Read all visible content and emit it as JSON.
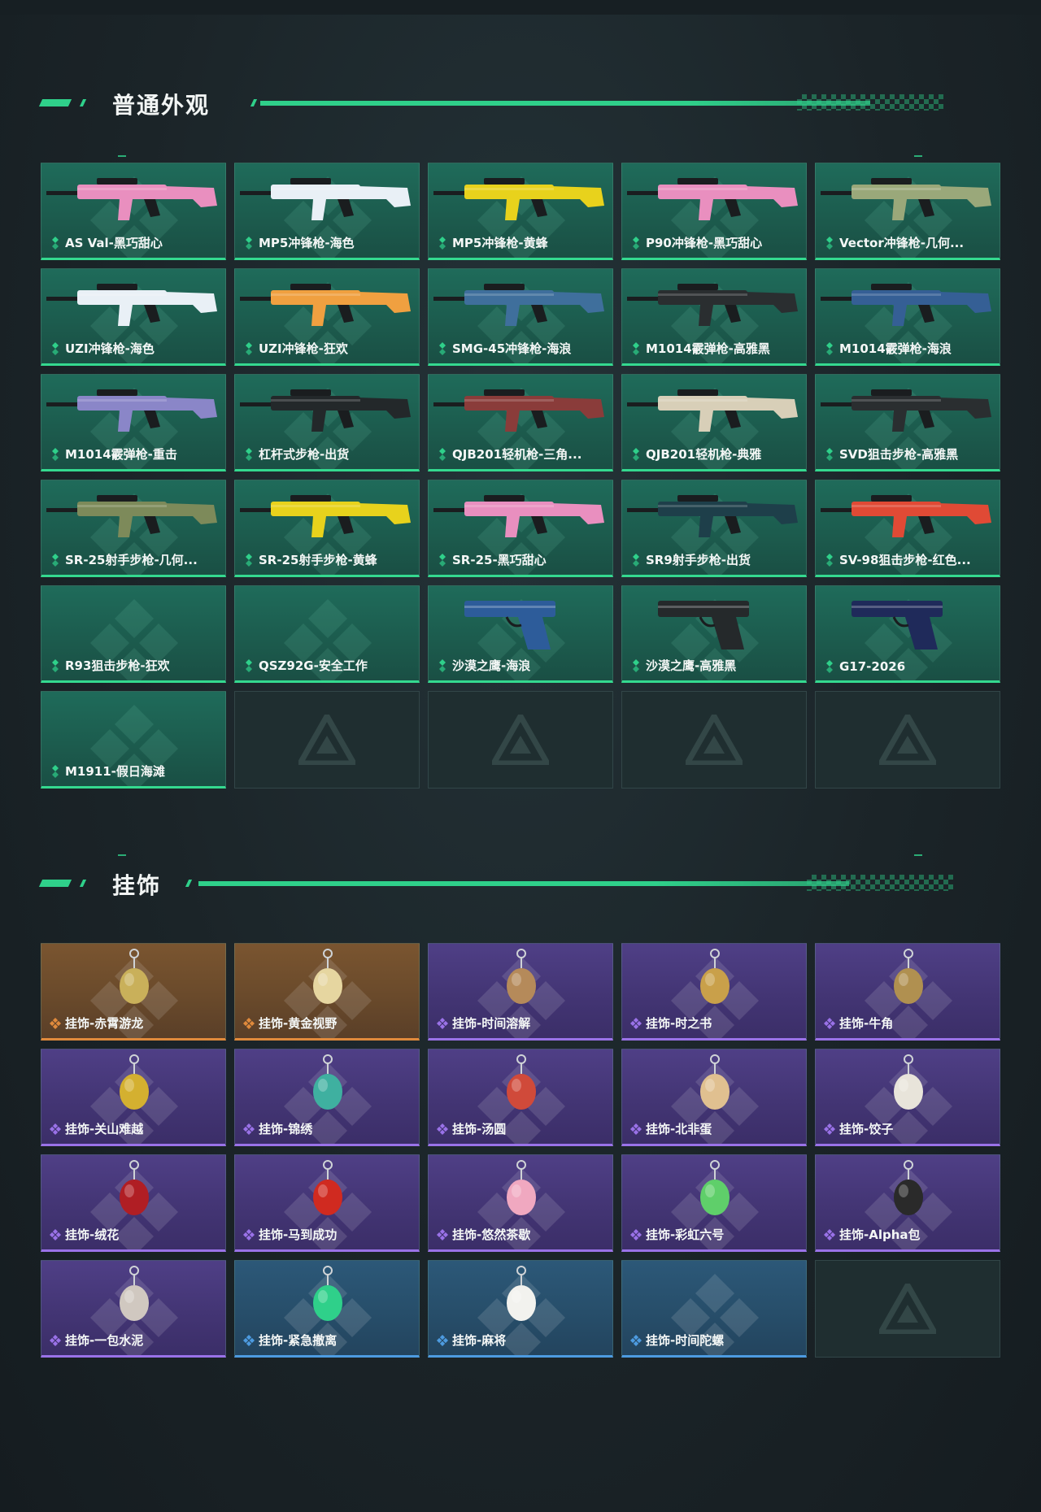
{
  "colors": {
    "accent_green": "#2fd08a",
    "skin_card": "#1f6b5a",
    "purple_card": "#4f3f86",
    "orange_card": "#7a5530",
    "blue_card": "#2c5878",
    "empty_card": "#1f2e30"
  },
  "sections": {
    "skins": {
      "title": "普通外观",
      "items": [
        {
          "label": "AS Val-黑巧甜心",
          "icon": "pink-rifle-icon",
          "tint": "#e98fbf"
        },
        {
          "label": "MP5冲锋枪-海色",
          "icon": "white-smg-icon",
          "tint": "#e9f0f6"
        },
        {
          "label": "MP5冲锋枪-黄蜂",
          "icon": "yellow-smg-icon",
          "tint": "#e8d21c"
        },
        {
          "label": "P90冲锋枪-黑巧甜心",
          "icon": "pink-p90-icon",
          "tint": "#e98fbf"
        },
        {
          "label": "Vector冲锋枪-几何...",
          "icon": "camo-smg-icon",
          "tint": "#9aa87a"
        },
        {
          "label": "UZI冲锋枪-海色",
          "icon": "white-uzi-icon",
          "tint": "#e9f0f6"
        },
        {
          "label": "UZI冲锋枪-狂欢",
          "icon": "colorful-uzi-icon",
          "tint": "#f0a040"
        },
        {
          "label": "SMG-45冲锋枪-海浪",
          "icon": "blue-smg-icon",
          "tint": "#3f6f9c"
        },
        {
          "label": "M1014霰弹枪-高雅黑",
          "icon": "black-shotgun-icon",
          "tint": "#2a2e30"
        },
        {
          "label": "M1014霰弹枪-海浪",
          "icon": "blue-shotgun-icon",
          "tint": "#355f95"
        },
        {
          "label": "M1014霰弹枪-重击",
          "icon": "purple-shotgun-icon",
          "tint": "#8a86c8"
        },
        {
          "label": "杠杆式步枪-出货",
          "icon": "black-rifle-icon",
          "tint": "#23282a"
        },
        {
          "label": "QJB201轻机枪-三角...",
          "icon": "red-lmg-icon",
          "tint": "#8a3c3a"
        },
        {
          "label": "QJB201轻机枪-典雅",
          "icon": "cream-lmg-icon",
          "tint": "#d8cfb8"
        },
        {
          "label": "SVD狙击步枪-高雅黑",
          "icon": "black-sniper-icon",
          "tint": "#2a2e30"
        },
        {
          "label": "SR-25射手步枪-几何...",
          "icon": "camo-rifle-icon",
          "tint": "#7d8a5a"
        },
        {
          "label": "SR-25射手步枪-黄蜂",
          "icon": "yellow-rifle-icon",
          "tint": "#e8d21c"
        },
        {
          "label": "SR-25-黑巧甜心",
          "icon": "pink-rifle-icon",
          "tint": "#e98fbf"
        },
        {
          "label": "SR9射手步枪-出货",
          "icon": "teal-rifle-icon",
          "tint": "#1e3f4a"
        },
        {
          "label": "SV-98狙击步枪-红色...",
          "icon": "red-sniper-icon",
          "tint": "#e04a35"
        },
        {
          "label": "R93狙击步枪-狂欢",
          "icon": "",
          "tint": ""
        },
        {
          "label": "QSZ92G-安全工作",
          "icon": "",
          "tint": ""
        },
        {
          "label": "沙漠之鹰-海浪",
          "icon": "blue-pistol-icon",
          "tint": "#2d5c9a"
        },
        {
          "label": "沙漠之鹰-高雅黑",
          "icon": "black-pistol-icon",
          "tint": "#25292b"
        },
        {
          "label": "G17-2026",
          "icon": "navy-pistol-icon",
          "tint": "#1f2a5a"
        },
        {
          "label": "M1911-假日海滩",
          "icon": "",
          "tint": ""
        }
      ],
      "empty_slots": 4
    },
    "charms": {
      "title": "挂饰",
      "items": [
        {
          "label": "挂饰-赤霄游龙",
          "rarity": "orange",
          "tint": "#c9b05a"
        },
        {
          "label": "挂饰-黄金视野",
          "rarity": "orange",
          "tint": "#e6d6a0"
        },
        {
          "label": "挂饰-时间溶解",
          "rarity": "purple",
          "tint": "#b58a5a"
        },
        {
          "label": "挂饰-时之书",
          "rarity": "purple",
          "tint": "#c9a04a"
        },
        {
          "label": "挂饰-牛角",
          "rarity": "purple",
          "tint": "#b09050"
        },
        {
          "label": "挂饰-关山难越",
          "rarity": "purple",
          "tint": "#d4b030"
        },
        {
          "label": "挂饰-锦绣",
          "rarity": "purple",
          "tint": "#3fb0a0"
        },
        {
          "label": "挂饰-汤圆",
          "rarity": "purple",
          "tint": "#d04a3a"
        },
        {
          "label": "挂饰-北非蛋",
          "rarity": "purple",
          "tint": "#e0c090"
        },
        {
          "label": "挂饰-饺子",
          "rarity": "purple",
          "tint": "#e8e4da"
        },
        {
          "label": "挂饰-绒花",
          "rarity": "purple",
          "tint": "#b01e24"
        },
        {
          "label": "挂饰-马到成功",
          "rarity": "purple",
          "tint": "#d02a20"
        },
        {
          "label": "挂饰-悠然茶歇",
          "rarity": "purple",
          "tint": "#f0a8c0"
        },
        {
          "label": "挂饰-彩虹六号",
          "rarity": "purple",
          "tint": "#5fcf6a"
        },
        {
          "label": "挂饰-Alpha包",
          "rarity": "purple",
          "tint": "#2a2a2a"
        },
        {
          "label": "挂饰-一包水泥",
          "rarity": "purple",
          "tint": "#d0c8c0"
        },
        {
          "label": "挂饰-紧急撤离",
          "rarity": "blue",
          "tint": "#2fd08a"
        },
        {
          "label": "挂饰-麻将",
          "rarity": "blue",
          "tint": "#f2f2ee"
        },
        {
          "label": "挂饰-时间陀螺",
          "rarity": "blue",
          "tint": ""
        }
      ],
      "empty_slots": 1
    }
  }
}
